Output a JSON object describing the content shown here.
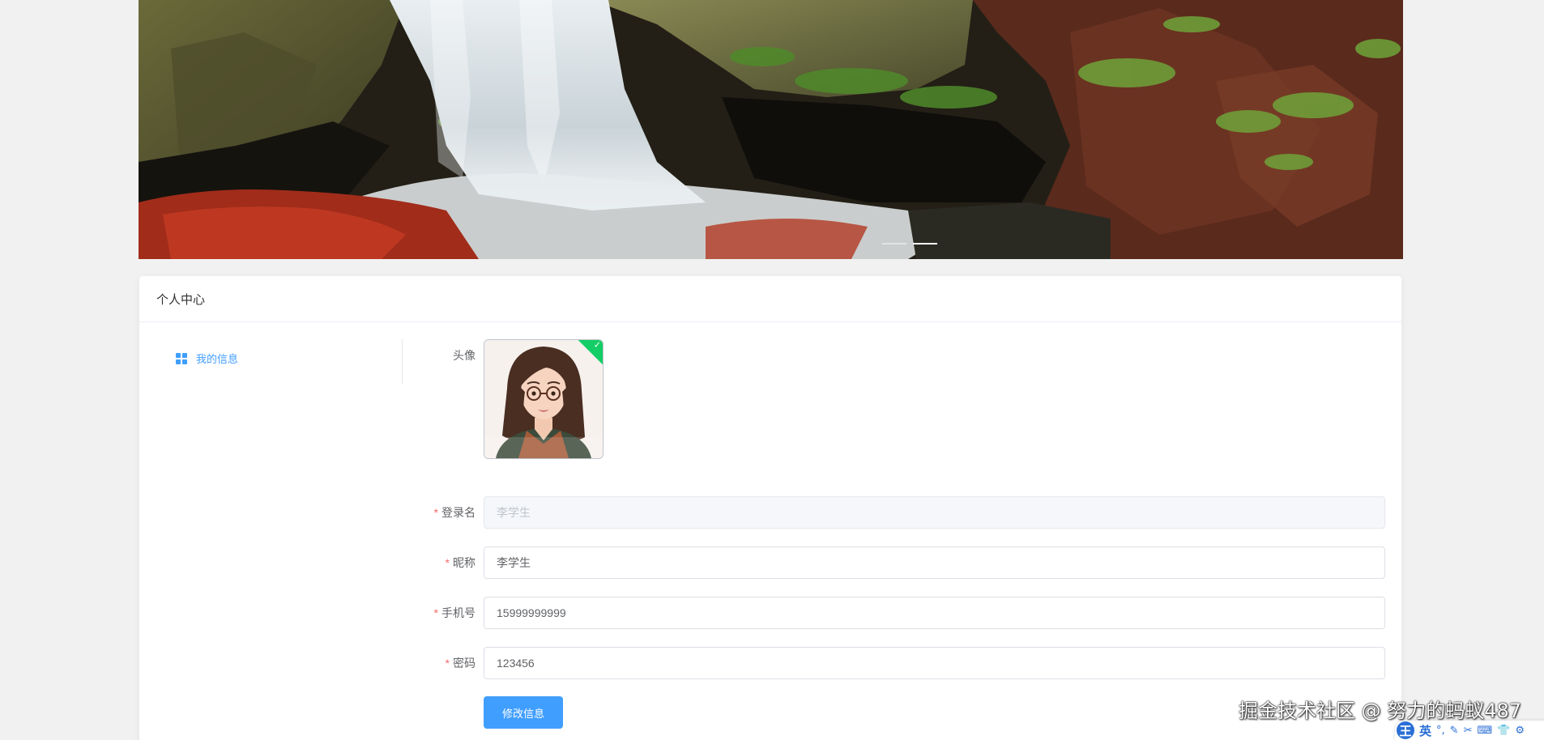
{
  "banner": {
    "active_slide": 1,
    "slide_count": 2
  },
  "card": {
    "title": "个人中心"
  },
  "sidebar": {
    "items": [
      {
        "label": "我的信息",
        "icon": "grid-icon",
        "active": true
      }
    ]
  },
  "form": {
    "avatar_label": "头像",
    "login_label": "登录名",
    "login_value": "李学生",
    "nickname_label": "昵称",
    "nickname_value": "李学生",
    "phone_label": "手机号",
    "phone_value": "15999999999",
    "password_label": "密码",
    "password_value": "123456",
    "required_mark": "*",
    "submit_label": "修改信息",
    "avatar_status_icon": "check-icon"
  },
  "overlay": {
    "watermark": "掘金技术社区 @ 努力的蚂蚁487",
    "ime_logo": "王",
    "ime_lang": "英",
    "ime_tools": [
      "°,",
      "✎",
      "✂",
      "⌨",
      "👕",
      "⚙"
    ]
  },
  "colors": {
    "primary": "#409eff",
    "required": "#f56c6c",
    "success": "#13ce66",
    "page_bg": "#f1f1f1"
  }
}
